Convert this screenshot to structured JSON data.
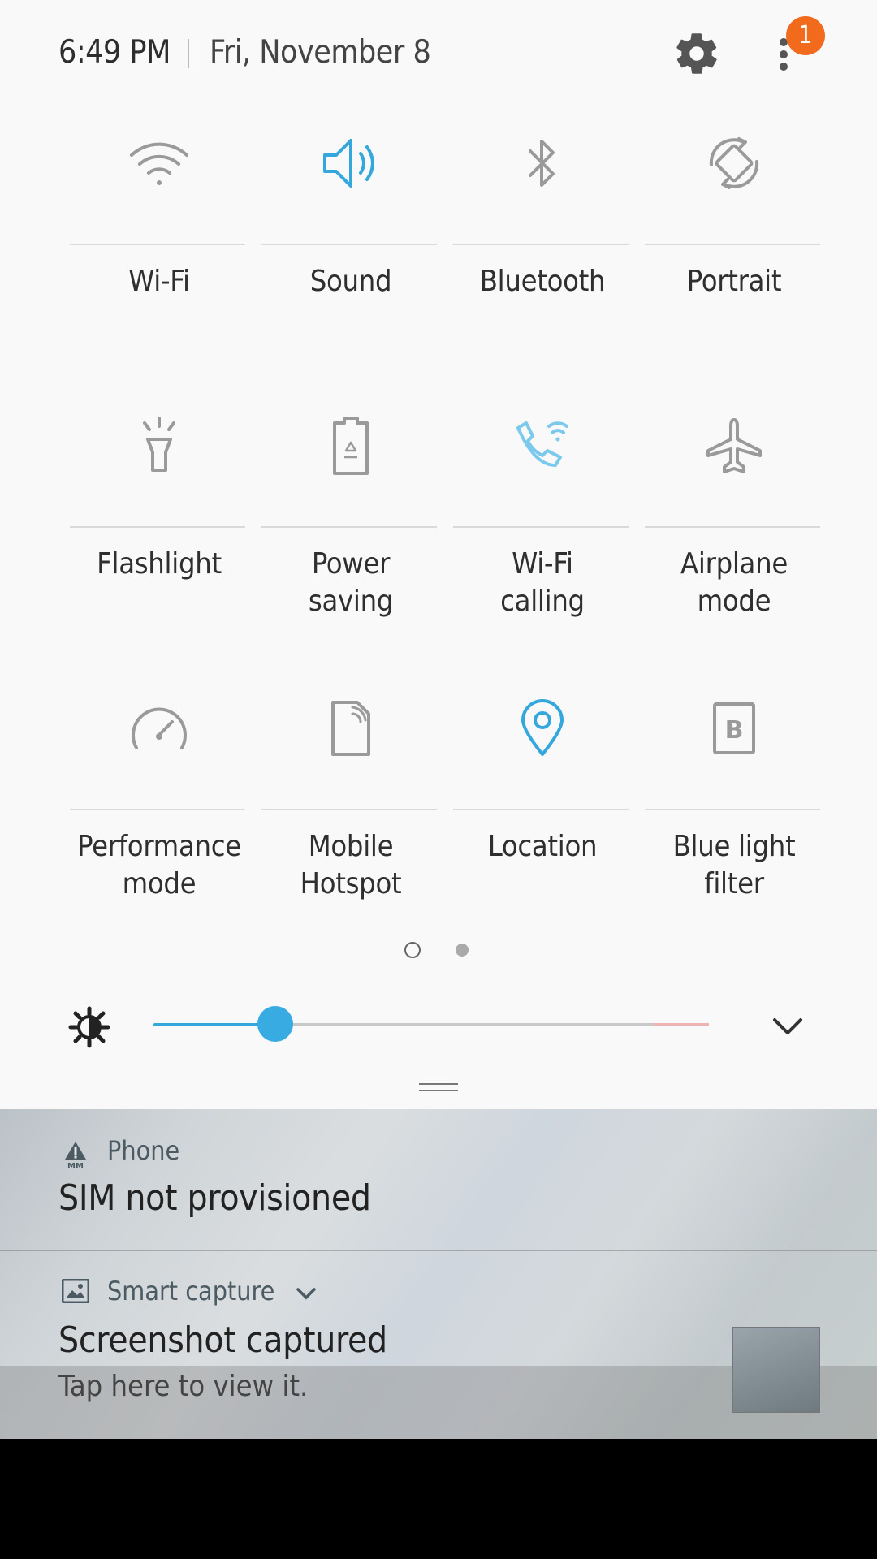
{
  "status": {
    "time": "6:49 PM",
    "date": "Fri, November 8",
    "notification_count": "1"
  },
  "tiles": [
    {
      "label": "Wi-Fi",
      "icon": "wifi-icon",
      "active": false
    },
    {
      "label": "Sound",
      "icon": "sound-icon",
      "active": true
    },
    {
      "label": "Bluetooth",
      "icon": "bluetooth-icon",
      "active": false
    },
    {
      "label": "Portrait",
      "icon": "portrait-rotation-icon",
      "active": false
    },
    {
      "label": "Flashlight",
      "icon": "flashlight-icon",
      "active": false
    },
    {
      "label": "Power\nsaving",
      "icon": "power-saving-icon",
      "active": false
    },
    {
      "label": "Wi-Fi\ncalling",
      "icon": "wifi-calling-icon",
      "active": true
    },
    {
      "label": "Airplane\nmode",
      "icon": "airplane-icon",
      "active": false
    },
    {
      "label": "Performance\nmode",
      "icon": "performance-icon",
      "active": false
    },
    {
      "label": "Mobile\nHotspot",
      "icon": "hotspot-icon",
      "active": false
    },
    {
      "label": "Location",
      "icon": "location-icon",
      "active": true
    },
    {
      "label": "Blue light\nfilter",
      "icon": "blue-light-icon",
      "active": false
    }
  ],
  "brightness": {
    "level": 0.22
  },
  "notifications": [
    {
      "app": "Phone",
      "title": "SIM not provisioned",
      "text": ""
    },
    {
      "app": "Smart capture",
      "title": "Screenshot captured",
      "text": "Tap here to view it."
    }
  ],
  "colors": {
    "accent": "#34a7dd",
    "badge": "#f26a1b",
    "icon_inactive": "#9a9a9a"
  }
}
